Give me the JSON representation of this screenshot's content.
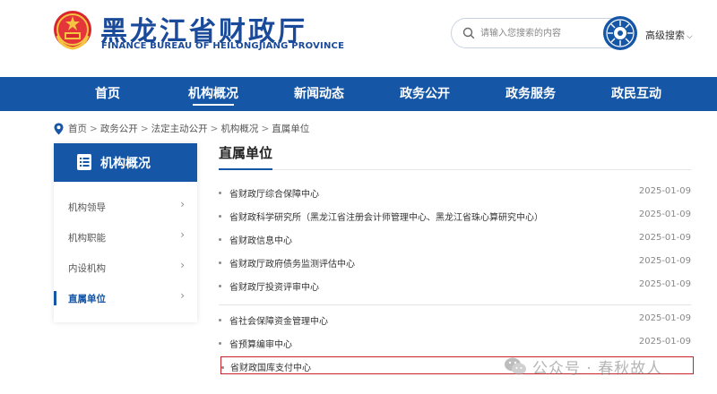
{
  "header": {
    "title_cn": "黑龙江省财政厅",
    "title_en": "FINANCE BUREAU OF HEILONGJIANG PROVINCE",
    "emblem_icon": "national-emblem-icon",
    "search_placeholder": "请输入您搜索的内容",
    "search_icon": "search-icon",
    "seal_icon": "search-seal-icon",
    "advanced_search": "高级搜索",
    "advanced_search_icon": "chevron-down-icon"
  },
  "nav": {
    "items": [
      {
        "label": "首页",
        "active": false
      },
      {
        "label": "机构概况",
        "active": true
      },
      {
        "label": "新闻动态",
        "active": false
      },
      {
        "label": "政务公开",
        "active": false
      },
      {
        "label": "政务服务",
        "active": false
      },
      {
        "label": "政民互动",
        "active": false
      }
    ]
  },
  "breadcrumb": {
    "icon": "location-pin-icon",
    "separator": ">",
    "items": [
      "首页",
      "政务公开",
      "法定主动公开",
      "机构概况",
      "直属单位"
    ]
  },
  "sidebar": {
    "title": "机构概况",
    "title_icon": "document-list-icon",
    "items": [
      {
        "label": "机构领导",
        "active": false
      },
      {
        "label": "机构职能",
        "active": false
      },
      {
        "label": "内设机构",
        "active": false
      },
      {
        "label": "直属单位",
        "active": true
      }
    ],
    "chevron": "›"
  },
  "main": {
    "title": "直属单位",
    "items": [
      {
        "title": "省财政厅综合保障中心",
        "date": "2025-01-09"
      },
      {
        "title": "省财政科学研究所（黑龙江省注册会计师管理中心、黑龙江省珠心算研究中心）",
        "date": "2025-01-09"
      },
      {
        "title": "省财政信息中心",
        "date": "2025-01-09"
      },
      {
        "title": "省财政厅政府债务监测评估中心",
        "date": "2025-01-09"
      },
      {
        "title": "省财政厅投资评审中心",
        "date": "2025-01-09"
      },
      {
        "title": "省社会保障资金管理中心",
        "date": "2025-01-09"
      },
      {
        "title": "省预算编审中心",
        "date": "2025-01-09"
      },
      {
        "title": "省财政国库支付中心",
        "date": ""
      }
    ],
    "highlight_color": "#c8232c"
  },
  "watermark": {
    "icon": "wechat-icon",
    "text": "公众号 · 春秋故人"
  },
  "colors": {
    "brand_blue": "#1556a6",
    "title_blue": "#1a4a9a"
  }
}
